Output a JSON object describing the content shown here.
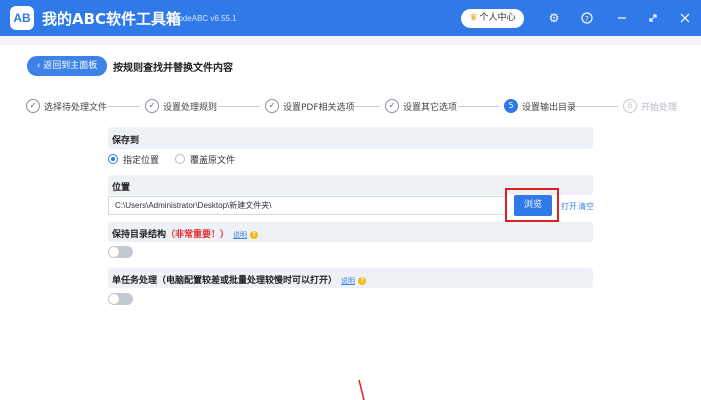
{
  "app": {
    "logo_text": "AB",
    "title": "我的ABC软件工具箱",
    "version": "WodeABC v6.55.1",
    "user_center": "个人中心"
  },
  "header": {
    "back_label": "返回到主面板",
    "page_title": "按规则查找并替换文件内容"
  },
  "steps": [
    {
      "num": "✓",
      "label": "选择待处理文件",
      "state": "done"
    },
    {
      "num": "✓",
      "label": "设置处理规则",
      "state": "done"
    },
    {
      "num": "✓",
      "label": "设置PDF相关选项",
      "state": "done"
    },
    {
      "num": "✓",
      "label": "设置其它选项",
      "state": "done"
    },
    {
      "num": "5",
      "label": "设置输出目录",
      "state": "active"
    },
    {
      "num": "6",
      "label": "开始处理",
      "state": "future"
    }
  ],
  "save_to": {
    "title": "保存到",
    "option_specified": "指定位置",
    "option_overwrite": "覆盖原文件"
  },
  "location": {
    "title": "位置",
    "path_value": "C:\\Users\\Administrator\\Desktop\\新建文件夹\\",
    "browse_label": "浏览",
    "open_label": "打开",
    "clear_label": "清空"
  },
  "keep_structure": {
    "title": "保持目录结构",
    "warning": "（非常重要！）",
    "help_label": "说明",
    "enabled": false
  },
  "single_task": {
    "title": "单任务处理（电脑配置较差或批量处理较慢时可以打开）",
    "help_label": "说明",
    "enabled": false
  },
  "colors": {
    "brand": "#2f79e8",
    "warning": "#e03131",
    "highlight": "#e02020"
  }
}
